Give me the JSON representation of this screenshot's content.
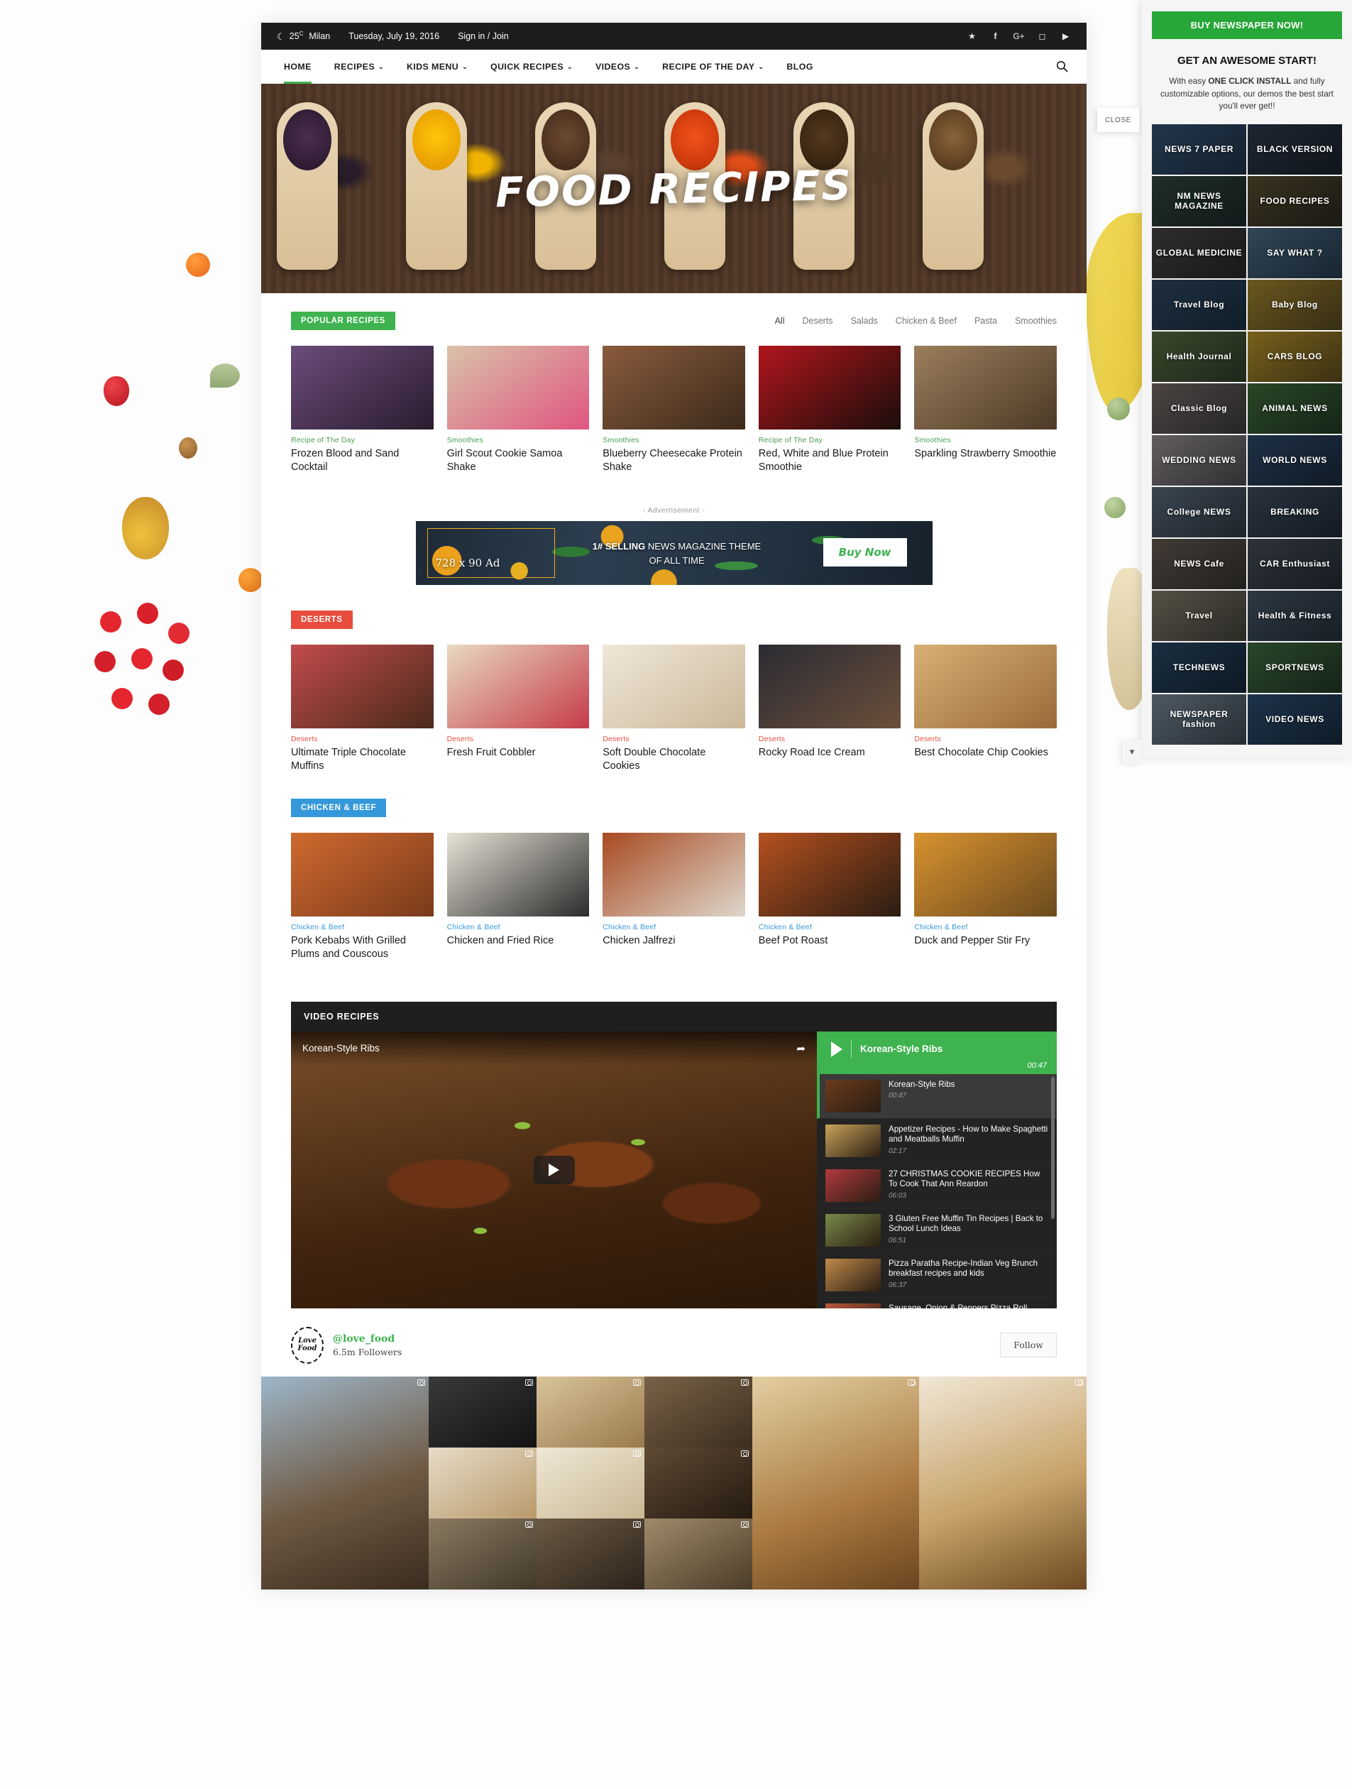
{
  "topbar": {
    "weather_icon": "moon-icon",
    "temperature": "25",
    "unit": "C",
    "city": "Milan",
    "date": "Tuesday, July 19, 2016",
    "auth": "Sign in / Join",
    "social": [
      "vimeo-icon",
      "facebook-icon",
      "google-plus-icon",
      "instagram-icon",
      "youtube-icon"
    ]
  },
  "menu": {
    "items": [
      {
        "label": "HOME",
        "caret": false,
        "active": true
      },
      {
        "label": "RECIPES",
        "caret": true,
        "active": false
      },
      {
        "label": "KIDS MENU",
        "caret": true,
        "active": false
      },
      {
        "label": "QUICK RECIPES",
        "caret": true,
        "active": false
      },
      {
        "label": "VIDEOS",
        "caret": true,
        "active": false
      },
      {
        "label": "RECIPE OF THE DAY",
        "caret": true,
        "active": false
      },
      {
        "label": "BLOG",
        "caret": false,
        "active": false
      }
    ],
    "search_icon": "search-icon"
  },
  "hero": {
    "title": "FOOD RECIPES"
  },
  "popular": {
    "badge": "POPULAR RECIPES",
    "badge_color": "#3eb34f",
    "filters": [
      {
        "label": "All",
        "active": true
      },
      {
        "label": "Deserts",
        "active": false
      },
      {
        "label": "Salads",
        "active": false
      },
      {
        "label": "Chicken & Beef",
        "active": false
      },
      {
        "label": "Pasta",
        "active": false
      },
      {
        "label": "Smoothies",
        "active": false
      }
    ],
    "cat_color": "#4a9c4f",
    "cards": [
      {
        "cat": "Recipe of The Day",
        "title": "Frozen Blood and Sand Cocktail",
        "c1": "#6b4d7a",
        "c2": "#2a1b2e"
      },
      {
        "cat": "Smoothies",
        "title": "Girl Scout Cookie Samoa Shake",
        "c1": "#d9c2aa",
        "c2": "#e0557f"
      },
      {
        "cat": "Smoothies",
        "title": "Blueberry Cheesecake Protein Shake",
        "c1": "#8a5b3c",
        "c2": "#3b2a1c"
      },
      {
        "cat": "Recipe of The Day",
        "title": "Red, White and Blue Protein Smoothie",
        "c1": "#b1161d",
        "c2": "#1a0d0b"
      },
      {
        "cat": "Smoothies",
        "title": "Sparkling Strawberry Smoothie",
        "c1": "#9b7e5c",
        "c2": "#4c3a27"
      }
    ]
  },
  "ad": {
    "label": "- Advertisement -",
    "size_text": "728 x 90 Ad",
    "headline_bold": "1# SELLING",
    "headline_rest": " NEWS MAGAZINE THEME",
    "headline_line2": "OF ALL TIME",
    "button": "Buy Now"
  },
  "deserts": {
    "badge": "DESERTS",
    "badge_color": "#e74c3c",
    "cat_color": "#e74c3c",
    "cards": [
      {
        "cat": "Deserts",
        "title": "Ultimate Triple Chocolate Muffins",
        "c1": "#c24b4b",
        "c2": "#4a2a1c"
      },
      {
        "cat": "Deserts",
        "title": "Fresh Fruit Cobbler",
        "c1": "#e8d9c1",
        "c2": "#c53b4a"
      },
      {
        "cat": "Deserts",
        "title": "Soft Double Chocolate Cookies",
        "c1": "#efe7d9",
        "c2": "#cbb89a"
      },
      {
        "cat": "Deserts",
        "title": "Rocky Road Ice Cream",
        "c1": "#2b2b33",
        "c2": "#6b4f3a"
      },
      {
        "cat": "Deserts",
        "title": "Best Chocolate Chip Cookies",
        "c1": "#d8b074",
        "c2": "#9a6a3a"
      }
    ]
  },
  "chicken_beef": {
    "badge": "CHICKEN & BEEF",
    "badge_color": "#3498db",
    "cat_color": "#3498db",
    "cards": [
      {
        "cat": "Chicken & Beef",
        "title": "Pork Kebabs With Grilled Plums and Couscous",
        "c1": "#cf6a2e",
        "c2": "#7a3a1c"
      },
      {
        "cat": "Chicken & Beef",
        "title": "Chicken and Fried Rice",
        "c1": "#e7e2d6",
        "c2": "#2b2b2b"
      },
      {
        "cat": "Chicken & Beef",
        "title": "Chicken Jalfrezi",
        "c1": "#a84a22",
        "c2": "#ded7cb"
      },
      {
        "cat": "Chicken & Beef",
        "title": "Beef Pot Roast",
        "c1": "#b5511f",
        "c2": "#2a1c12"
      },
      {
        "cat": "Chicken & Beef",
        "title": "Duck and Pepper Stir Fry",
        "c1": "#d9922f",
        "c2": "#6b4a1e"
      }
    ]
  },
  "video": {
    "section_title": "VIDEO RECIPES",
    "player_title": "Korean-Style Ribs",
    "share_icon": "share-icon",
    "play_icon": "play-icon",
    "now_playing": "Korean-Style Ribs",
    "now_playing_time": "00:47",
    "playlist": [
      {
        "title": "Korean-Style Ribs",
        "time": "00:47",
        "selected": true
      },
      {
        "title": "Appetizer Recipes - How to Make Spaghetti and Meatballs Muffin",
        "time": "02:17",
        "selected": false
      },
      {
        "title": "27 CHRISTMAS COOKIE RECIPES How To Cook That Ann Reardon",
        "time": "06:03",
        "selected": false
      },
      {
        "title": "3 Gluten Free Muffin Tin Recipes | Back to School Lunch Ideas",
        "time": "06:51",
        "selected": false
      },
      {
        "title": "Pizza Paratha Recipe-Indian Veg Brunch breakfast recipes and kids",
        "time": "06:37",
        "selected": false
      },
      {
        "title": "Sausage, Onion & Peppers Pizza Roll",
        "time": "",
        "selected": false
      }
    ]
  },
  "instagram": {
    "logo_line1": "Love",
    "logo_line2": "Food",
    "handle": "@love_food",
    "followers": "6.5m Followers",
    "follow_button": "Follow"
  },
  "demo_panel": {
    "buy_button": "BUY NEWSPAPER NOW!",
    "heading": "GET AN AWESOME START!",
    "body_pre": "With easy ",
    "body_bold": "ONE CLICK INSTALL",
    "body_post": " and fully customizable options, our demos the best start you'll ever get!!",
    "close_label": "CLOSE",
    "chevron_icon": "chevron-down-icon",
    "demos": [
      {
        "label": "NEWS 7 PAPER",
        "c1": "#32506e",
        "c2": "#1b2a3c"
      },
      {
        "label": "BLACK VERSION",
        "c1": "#2b3440",
        "c2": "#14181e"
      },
      {
        "label": "NM NEWS MAGAZINE",
        "c1": "#2e4230",
        "c2": "#16201a"
      },
      {
        "label": "FOOD RECIPES",
        "c1": "#5a4a22",
        "c2": "#241d0e"
      },
      {
        "label": "GLOBAL MEDICINE",
        "c1": "#4a4038",
        "c2": "#221d18"
      },
      {
        "label": "SAY WHAT ?",
        "c1": "#4c6b80",
        "c2": "#223340"
      },
      {
        "label": "Travel Blog",
        "c1": "#2d4459",
        "c2": "#152633"
      },
      {
        "label": "Baby Blog",
        "c1": "#b08a22",
        "c2": "#55410e"
      },
      {
        "label": "Health Journal",
        "c1": "#5a6e36",
        "c2": "#2b361a"
      },
      {
        "label": "CARS BLOG",
        "c1": "#c79a1e",
        "c2": "#5c460c"
      },
      {
        "label": "Classic Blog",
        "c1": "#7a6a60",
        "c2": "#3a322c"
      },
      {
        "label": "ANIMAL NEWS",
        "c1": "#3f6b2e",
        "c2": "#1d3315"
      },
      {
        "label": "WEDDING NEWS",
        "c1": "#a09391",
        "c2": "#4b4442"
      },
      {
        "label": "WORLD NEWS",
        "c1": "#2d4663",
        "c2": "#13202e"
      },
      {
        "label": "College NEWS",
        "c1": "#5d6a74",
        "c2": "#2a3238"
      },
      {
        "label": "BREAKING",
        "c1": "#3e4a56",
        "c2": "#1a2028"
      },
      {
        "label": "NEWS Cafe",
        "c1": "#6a5948",
        "c2": "#322a20"
      },
      {
        "label": "CAR Enthusiast",
        "c1": "#474b50",
        "c2": "#202225"
      },
      {
        "label": "Travel",
        "c1": "#8a7d62",
        "c2": "#413a2c"
      },
      {
        "label": "Health & Fitness",
        "c1": "#46545f",
        "c2": "#1f272d"
      },
      {
        "label": "TECHNEWS",
        "c1": "#26435c",
        "c2": "#0f1d29"
      },
      {
        "label": "SPORTNEWS",
        "c1": "#3f6b33",
        "c2": "#1c3117"
      },
      {
        "label": "NEWSPAPER fashion",
        "c1": "#7d8c96",
        "c2": "#3a4248"
      },
      {
        "label": "VIDEO NEWS",
        "c1": "#2b4b6b",
        "c2": "#112231"
      }
    ]
  }
}
